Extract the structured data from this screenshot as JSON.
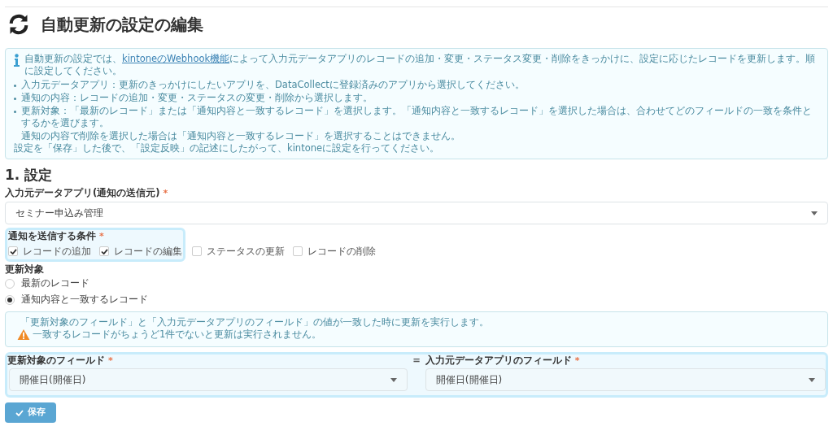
{
  "title": "自動更新の設定の編集",
  "info": {
    "before": "自動更新の設定では、",
    "link": "kintoneのWebhook機能",
    "after": "によって入力元データアプリのレコードの追加・変更・ステータス変更・削除をきっかけに、設定に応じたレコードを更新します。順に設定してください。",
    "bullets": [
      "入力元データアプリ：更新のきっかけにしたいアプリを、DataCollectに登録済みのアプリから選択してください。",
      "通知の内容：レコードの追加・変更・ステータスの変更・削除から選択します。",
      "更新対象：「最新のレコード」または「通知内容と一致するレコード」を選択します。「通知内容と一致するレコード」を選択した場合は、合わせてどのフィールドの一致を条件とするかを選びます。"
    ],
    "bullet_continuation": "通知の内容で削除を選択した場合は「通知内容と一致するレコード」を選択することはできません。",
    "footer": "設定を「保存」した後で、「設定反映」の記述にしたがって、kintoneに設定を行ってください。"
  },
  "section": "1. 設定",
  "source_app": {
    "label": "入力元データアプリ(通知の送信元)",
    "required_mark": "*",
    "value": "セミナー申込み管理"
  },
  "conditions": {
    "label": "通知を送信する条件",
    "required_mark": "*",
    "options": [
      {
        "label": "レコードの追加",
        "checked": true
      },
      {
        "label": "レコードの編集",
        "checked": true
      },
      {
        "label": "ステータスの更新",
        "checked": false
      },
      {
        "label": "レコードの削除",
        "checked": false
      }
    ]
  },
  "target": {
    "label": "更新対象",
    "options": [
      {
        "label": "最新のレコード",
        "selected": false
      },
      {
        "label": "通知内容と一致するレコード",
        "selected": true
      }
    ]
  },
  "notice": {
    "line1": "「更新対象のフィールド」と「入力元データアプリのフィールド」の値が一致した時に更新を実行します。",
    "warning": "一致するレコードがちょうど1件でないと更新は実行されません。"
  },
  "match": {
    "left": {
      "label": "更新対象のフィールド",
      "required_mark": "*",
      "value": "開催日(開催日)"
    },
    "equals": "=",
    "right": {
      "label": "入力元データアプリのフィールド",
      "required_mark": "*",
      "value": "開催日(開催日)"
    }
  },
  "save": "保存"
}
